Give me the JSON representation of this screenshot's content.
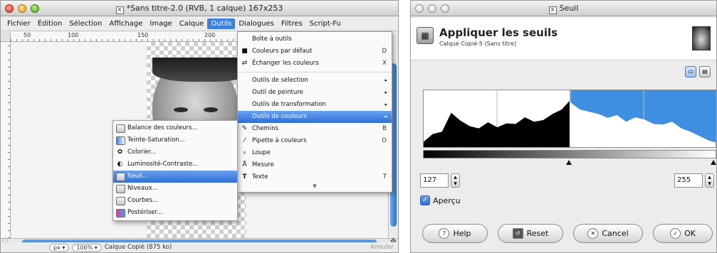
{
  "gimp": {
    "title": "*Sans titre-2.0 (RVB, 1 calque) 167x253",
    "menus": [
      "Fichier",
      "Édition",
      "Sélection",
      "Affichage",
      "Image",
      "Calque",
      "Outils",
      "Dialogues",
      "Filtres",
      "Script-Fu"
    ],
    "active_menu": "Outils",
    "ruler_marks": [
      "50",
      "100",
      "150",
      "200"
    ],
    "status": {
      "unit": "px",
      "zoom": "100%",
      "layer_info": "Calque Copié (875 ko)",
      "cancel": "Annuler"
    }
  },
  "outils_menu": {
    "items": [
      {
        "label": "Boîte à outils",
        "shortcut": "",
        "icon": ""
      },
      {
        "label": "Couleurs par défaut",
        "shortcut": "D",
        "icon": "default-colors-icon"
      },
      {
        "label": "Échanger les couleurs",
        "shortcut": "X",
        "icon": "swap-colors-icon"
      },
      {
        "label": "Outils de sélection",
        "submenu": true
      },
      {
        "label": "Outil de peinture",
        "submenu": true
      },
      {
        "label": "Outils de transformation",
        "submenu": true
      },
      {
        "label": "Outils de couleurs",
        "submenu": true,
        "highlighted": true
      },
      {
        "label": "Chemins",
        "shortcut": "B",
        "icon": "paths-icon"
      },
      {
        "label": "Pipette à couleurs",
        "shortcut": "O",
        "icon": "color-picker-icon"
      },
      {
        "label": "Loupe",
        "shortcut": "",
        "icon": "zoom-icon"
      },
      {
        "label": "Mesure",
        "shortcut": "",
        "icon": "measure-icon"
      },
      {
        "label": "Texte",
        "shortcut": "T",
        "icon": "text-icon"
      }
    ]
  },
  "couleurs_submenu": {
    "items": [
      {
        "label": "Balance des couleurs..."
      },
      {
        "label": "Teinte-Saturation..."
      },
      {
        "label": "Colorier..."
      },
      {
        "label": "Luminosité-Contraste..."
      },
      {
        "label": "Seuil...",
        "highlighted": true
      },
      {
        "label": "Niveaux..."
      },
      {
        "label": "Courbes..."
      },
      {
        "label": "Postériser..."
      }
    ]
  },
  "seuil": {
    "window_title": "Seuil",
    "heading": "Appliquer les seuils",
    "subheading": "Calque Copié-5 (Sans titre)",
    "low": "127",
    "high": "255",
    "preview_label": "Aperçu",
    "preview_checked": true,
    "buttons": {
      "help": "Help",
      "reset": "Reset",
      "cancel": "Cancel",
      "ok": "OK"
    },
    "colors": {
      "highlight": "#3f8fe0",
      "histogram": "#000000"
    }
  },
  "chart_data": {
    "type": "area",
    "x": [
      0,
      8,
      16,
      24,
      32,
      40,
      48,
      56,
      64,
      72,
      80,
      88,
      96,
      104,
      112,
      120,
      127,
      128,
      136,
      144,
      152,
      160,
      168,
      176,
      184,
      192,
      200,
      208,
      216,
      224,
      232,
      240,
      248,
      255
    ],
    "values": [
      0.12,
      0.26,
      0.3,
      0.64,
      0.5,
      0.4,
      0.36,
      0.47,
      0.38,
      0.45,
      0.44,
      0.56,
      0.48,
      0.51,
      0.62,
      0.7,
      0.86,
      0.82,
      0.7,
      0.66,
      0.62,
      0.55,
      0.6,
      0.48,
      0.56,
      0.52,
      0.44,
      0.43,
      0.48,
      0.36,
      0.3,
      0.22,
      0.14,
      0.1
    ],
    "threshold_range": [
      127,
      255
    ]
  }
}
